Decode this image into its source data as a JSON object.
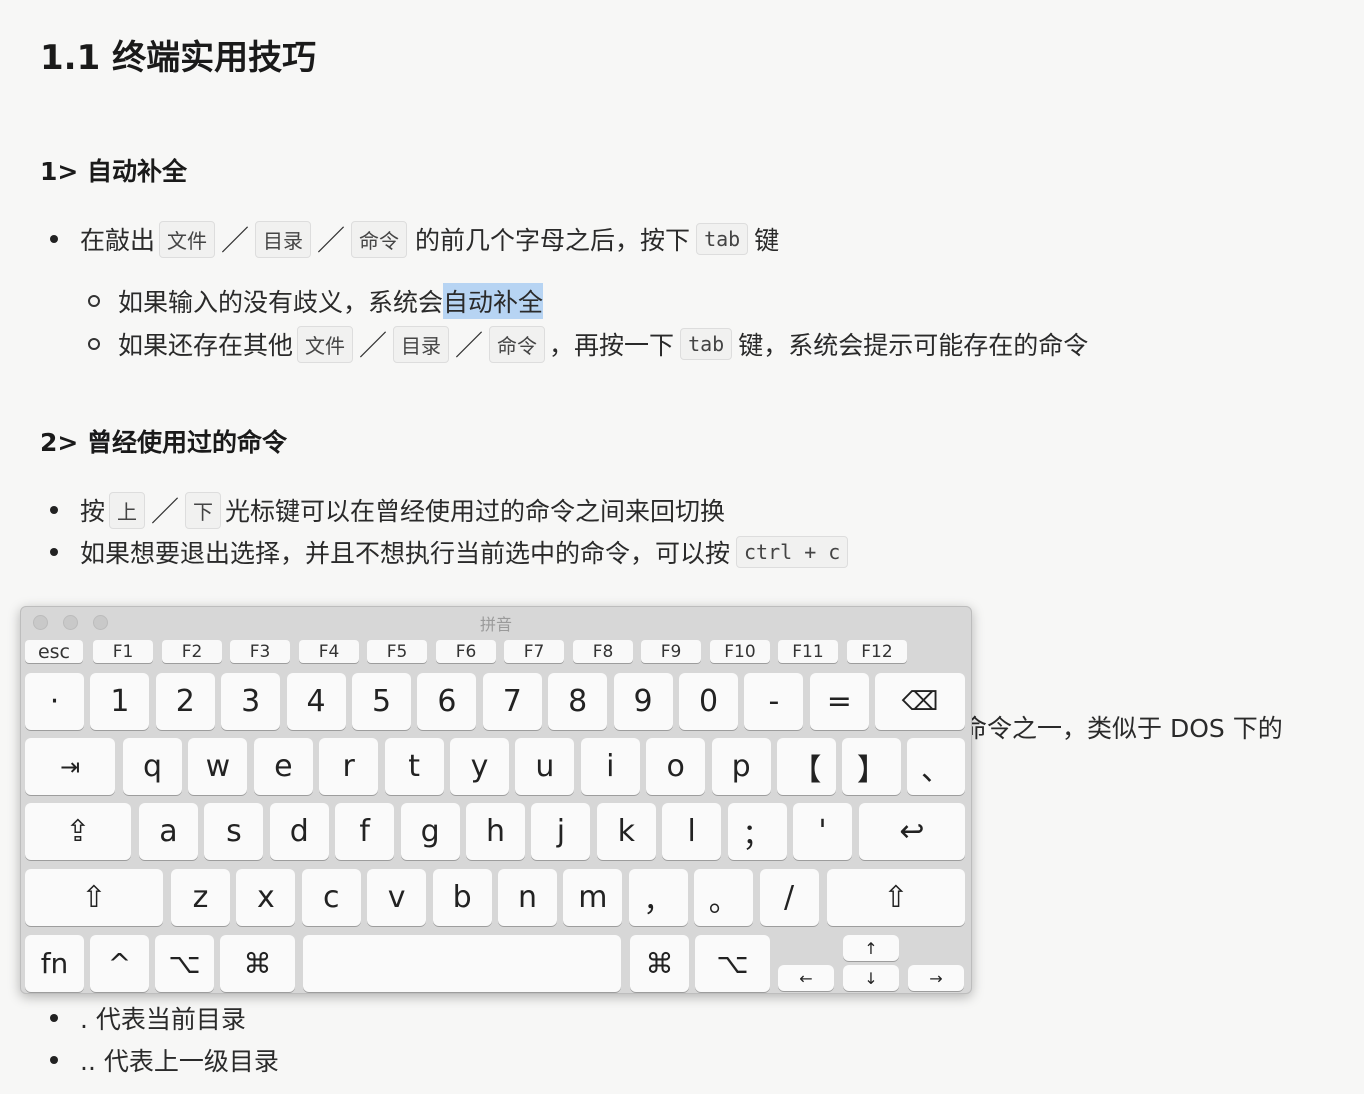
{
  "title": "1.1 终端实用技巧",
  "section1": {
    "heading": "1> 自动补全",
    "b1_pre": "在敲出",
    "b1_file": "文件",
    "b1_dir": "目录",
    "b1_cmd": "命令",
    "b1_mid": "的前几个字母之后，按下",
    "b1_tab": "tab",
    "b1_post": "键",
    "s1_pre": "如果输入的没有歧义，系统会",
    "s1_hl": "自动补全",
    "s2_pre": "如果还存在其他",
    "s2_file": "文件",
    "s2_dir": "目录",
    "s2_cmd": "命令",
    "s2_mid": "，再按一下",
    "s2_tab": "tab",
    "s2_post": "键，系统会提示可能存在的命令"
  },
  "section2": {
    "heading": "2> 曾经使用过的命令",
    "b1_pre": "按",
    "b1_up": "上",
    "b1_down": "下",
    "b1_post": "光标键可以在曾经使用过的命令之间来回切换",
    "b2_pre": "如果想要退出选择，并且不想执行当前选中的命令，可以按",
    "b2_code": "ctrl + c"
  },
  "partial_line": "命令之一，类似于 DOS 下的",
  "bottom": {
    "item1": ". 代表当前目录",
    "item2": ".. 代表上一级目录"
  },
  "keyboard": {
    "title": "拼音",
    "fkeys": [
      "esc",
      "F1",
      "F2",
      "F3",
      "F4",
      "F5",
      "F6",
      "F7",
      "F8",
      "F9",
      "F10",
      "F11",
      "F12"
    ],
    "row1": [
      "·",
      "1",
      "2",
      "3",
      "4",
      "5",
      "6",
      "7",
      "8",
      "9",
      "0",
      "-",
      "=",
      "⌫"
    ],
    "row2": [
      "⇥",
      "q",
      "w",
      "e",
      "r",
      "t",
      "y",
      "u",
      "i",
      "o",
      "p",
      "【",
      "】",
      "、"
    ],
    "row3": [
      "⇪",
      "a",
      "s",
      "d",
      "f",
      "g",
      "h",
      "j",
      "k",
      "l",
      "；",
      "'",
      "↩"
    ],
    "row4": [
      "⇧",
      "z",
      "x",
      "c",
      "v",
      "b",
      "n",
      "m",
      "，",
      "。",
      "/",
      "⇧"
    ],
    "row5": [
      "fn",
      "^",
      "⌥",
      "⌘",
      "",
      "⌘",
      "⌥"
    ],
    "arrows": [
      "↑",
      "←",
      "↓",
      "→"
    ]
  }
}
